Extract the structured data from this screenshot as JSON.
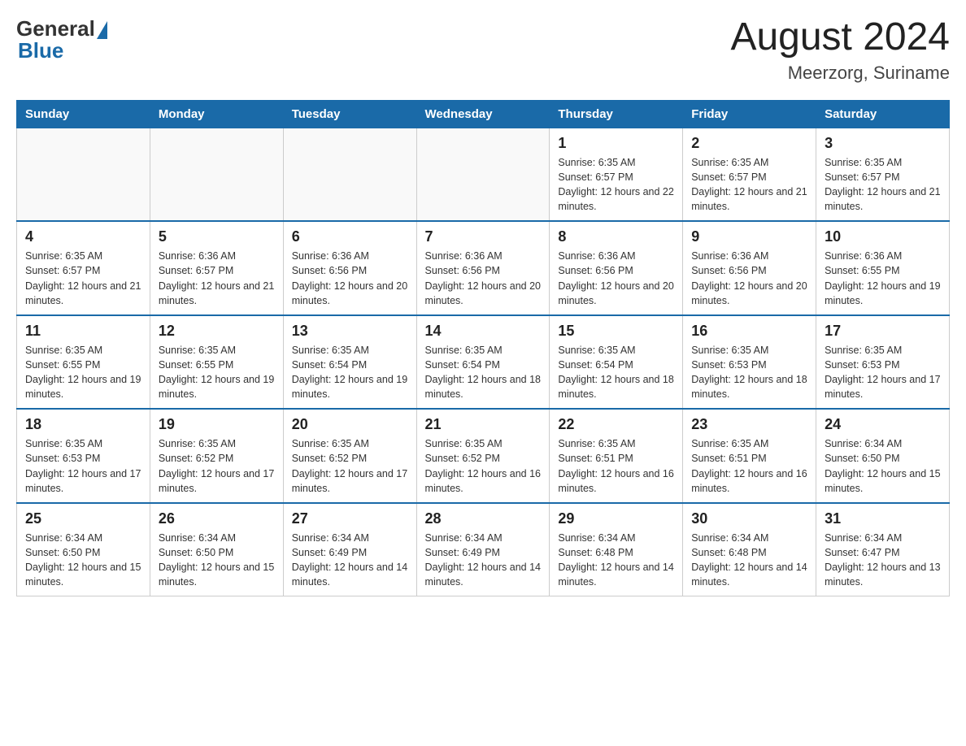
{
  "header": {
    "logo_general": "General",
    "logo_blue": "Blue",
    "month_year": "August 2024",
    "location": "Meerzorg, Suriname"
  },
  "weekdays": [
    "Sunday",
    "Monday",
    "Tuesday",
    "Wednesday",
    "Thursday",
    "Friday",
    "Saturday"
  ],
  "weeks": [
    [
      {
        "day": "",
        "info": ""
      },
      {
        "day": "",
        "info": ""
      },
      {
        "day": "",
        "info": ""
      },
      {
        "day": "",
        "info": ""
      },
      {
        "day": "1",
        "info": "Sunrise: 6:35 AM\nSunset: 6:57 PM\nDaylight: 12 hours and 22 minutes."
      },
      {
        "day": "2",
        "info": "Sunrise: 6:35 AM\nSunset: 6:57 PM\nDaylight: 12 hours and 21 minutes."
      },
      {
        "day": "3",
        "info": "Sunrise: 6:35 AM\nSunset: 6:57 PM\nDaylight: 12 hours and 21 minutes."
      }
    ],
    [
      {
        "day": "4",
        "info": "Sunrise: 6:35 AM\nSunset: 6:57 PM\nDaylight: 12 hours and 21 minutes."
      },
      {
        "day": "5",
        "info": "Sunrise: 6:36 AM\nSunset: 6:57 PM\nDaylight: 12 hours and 21 minutes."
      },
      {
        "day": "6",
        "info": "Sunrise: 6:36 AM\nSunset: 6:56 PM\nDaylight: 12 hours and 20 minutes."
      },
      {
        "day": "7",
        "info": "Sunrise: 6:36 AM\nSunset: 6:56 PM\nDaylight: 12 hours and 20 minutes."
      },
      {
        "day": "8",
        "info": "Sunrise: 6:36 AM\nSunset: 6:56 PM\nDaylight: 12 hours and 20 minutes."
      },
      {
        "day": "9",
        "info": "Sunrise: 6:36 AM\nSunset: 6:56 PM\nDaylight: 12 hours and 20 minutes."
      },
      {
        "day": "10",
        "info": "Sunrise: 6:36 AM\nSunset: 6:55 PM\nDaylight: 12 hours and 19 minutes."
      }
    ],
    [
      {
        "day": "11",
        "info": "Sunrise: 6:35 AM\nSunset: 6:55 PM\nDaylight: 12 hours and 19 minutes."
      },
      {
        "day": "12",
        "info": "Sunrise: 6:35 AM\nSunset: 6:55 PM\nDaylight: 12 hours and 19 minutes."
      },
      {
        "day": "13",
        "info": "Sunrise: 6:35 AM\nSunset: 6:54 PM\nDaylight: 12 hours and 19 minutes."
      },
      {
        "day": "14",
        "info": "Sunrise: 6:35 AM\nSunset: 6:54 PM\nDaylight: 12 hours and 18 minutes."
      },
      {
        "day": "15",
        "info": "Sunrise: 6:35 AM\nSunset: 6:54 PM\nDaylight: 12 hours and 18 minutes."
      },
      {
        "day": "16",
        "info": "Sunrise: 6:35 AM\nSunset: 6:53 PM\nDaylight: 12 hours and 18 minutes."
      },
      {
        "day": "17",
        "info": "Sunrise: 6:35 AM\nSunset: 6:53 PM\nDaylight: 12 hours and 17 minutes."
      }
    ],
    [
      {
        "day": "18",
        "info": "Sunrise: 6:35 AM\nSunset: 6:53 PM\nDaylight: 12 hours and 17 minutes."
      },
      {
        "day": "19",
        "info": "Sunrise: 6:35 AM\nSunset: 6:52 PM\nDaylight: 12 hours and 17 minutes."
      },
      {
        "day": "20",
        "info": "Sunrise: 6:35 AM\nSunset: 6:52 PM\nDaylight: 12 hours and 17 minutes."
      },
      {
        "day": "21",
        "info": "Sunrise: 6:35 AM\nSunset: 6:52 PM\nDaylight: 12 hours and 16 minutes."
      },
      {
        "day": "22",
        "info": "Sunrise: 6:35 AM\nSunset: 6:51 PM\nDaylight: 12 hours and 16 minutes."
      },
      {
        "day": "23",
        "info": "Sunrise: 6:35 AM\nSunset: 6:51 PM\nDaylight: 12 hours and 16 minutes."
      },
      {
        "day": "24",
        "info": "Sunrise: 6:34 AM\nSunset: 6:50 PM\nDaylight: 12 hours and 15 minutes."
      }
    ],
    [
      {
        "day": "25",
        "info": "Sunrise: 6:34 AM\nSunset: 6:50 PM\nDaylight: 12 hours and 15 minutes."
      },
      {
        "day": "26",
        "info": "Sunrise: 6:34 AM\nSunset: 6:50 PM\nDaylight: 12 hours and 15 minutes."
      },
      {
        "day": "27",
        "info": "Sunrise: 6:34 AM\nSunset: 6:49 PM\nDaylight: 12 hours and 14 minutes."
      },
      {
        "day": "28",
        "info": "Sunrise: 6:34 AM\nSunset: 6:49 PM\nDaylight: 12 hours and 14 minutes."
      },
      {
        "day": "29",
        "info": "Sunrise: 6:34 AM\nSunset: 6:48 PM\nDaylight: 12 hours and 14 minutes."
      },
      {
        "day": "30",
        "info": "Sunrise: 6:34 AM\nSunset: 6:48 PM\nDaylight: 12 hours and 14 minutes."
      },
      {
        "day": "31",
        "info": "Sunrise: 6:34 AM\nSunset: 6:47 PM\nDaylight: 12 hours and 13 minutes."
      }
    ]
  ]
}
